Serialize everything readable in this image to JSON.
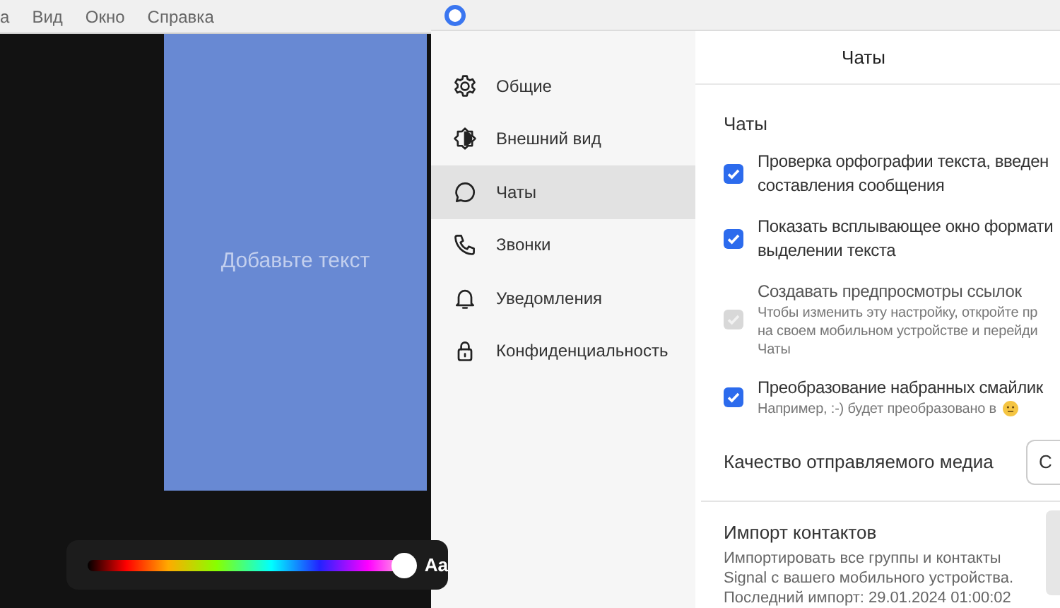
{
  "menu_bar": {
    "items": [
      "а",
      "Вид",
      "Окно",
      "Справка"
    ]
  },
  "editor": {
    "placeholder": "Добавьте текст",
    "color_slider": {
      "level": 0.98
    },
    "font_toggle": "Aa"
  },
  "settings_window": {
    "sidebar": {
      "items": [
        {
          "label": "Общие",
          "selected": false
        },
        {
          "label": "Внешний вид",
          "selected": false
        },
        {
          "label": "Чаты",
          "selected": true
        },
        {
          "label": "Звонки",
          "selected": false
        },
        {
          "label": "Уведомления",
          "selected": false
        },
        {
          "label": "Конфиденциальность",
          "selected": false
        }
      ]
    },
    "header": "Чаты",
    "section": "Чаты",
    "options": [
      {
        "lines": [
          "Проверка орфографии текста, введен",
          "составления сообщения"
        ],
        "checked": true,
        "disabled": false
      },
      {
        "lines": [
          "Показать всплывающее окно формати",
          "выделении текста"
        ],
        "checked": true,
        "disabled": false
      },
      {
        "lines": [
          "Создавать предпросмотры ссылок"
        ],
        "hint": [
          "Чтобы изменить эту настройку, откройте пр",
          "на своем мобильном устройстве и перейди",
          "Чаты"
        ],
        "checked": true,
        "disabled": true
      },
      {
        "lines": [
          "Преобразование набранных смайлик"
        ],
        "hint": [
          "Например, :-) будет преобразовано в"
        ],
        "emoji": true,
        "checked": true,
        "disabled": false
      }
    ],
    "media_quality": {
      "label": "Качество отправляемого медиа",
      "value": "С"
    },
    "import": {
      "title": "Импорт контактов",
      "lines": [
        "Импортировать все группы и контакты",
        "Signal с вашего мобильного устройства.",
        "Последний импорт: 29.01.2024 01:00:02"
      ]
    }
  }
}
